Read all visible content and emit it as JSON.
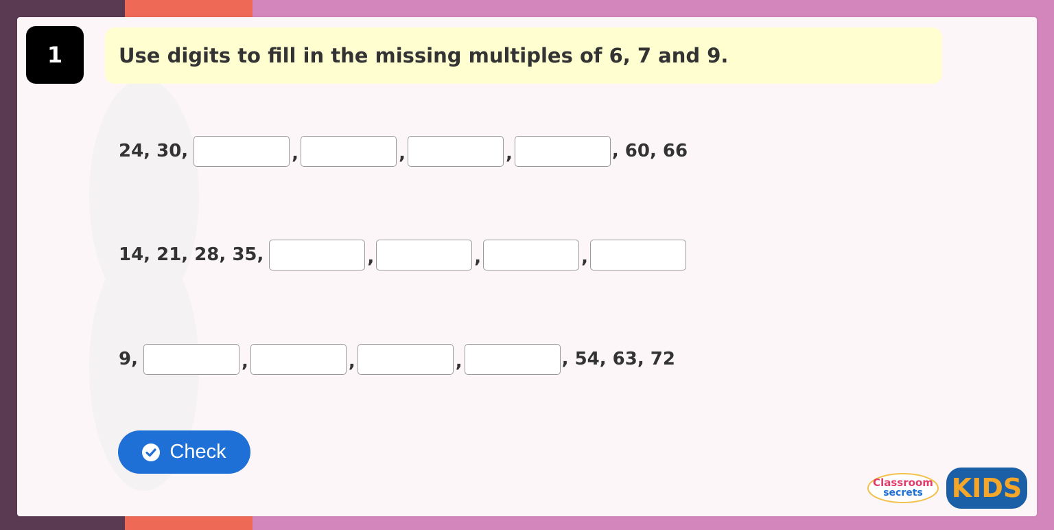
{
  "question": {
    "number": "1",
    "prompt": "Use digits to fill in the missing multiples of 6, 7 and 9."
  },
  "rows": [
    {
      "before": "24, 30,",
      "blanks": 4,
      "after": ", 60, 66"
    },
    {
      "before": "14, 21, 28, 35,",
      "blanks": 4,
      "after": ""
    },
    {
      "before": "9,",
      "blanks": 4,
      "after": ", 54, 63, 72"
    }
  ],
  "separator": ",",
  "check_button": {
    "label": "Check",
    "icon": "check-circle-icon"
  },
  "logo": {
    "line1": "Classroom",
    "line2": "secrets",
    "badge": "KIDS"
  },
  "colors": {
    "accent_blue": "#1f70d6",
    "prompt_bg": "#fffed0",
    "page_bg": "#d386bb",
    "stripe_dark": "#5a3a52",
    "stripe_orange": "#ee6a57"
  }
}
